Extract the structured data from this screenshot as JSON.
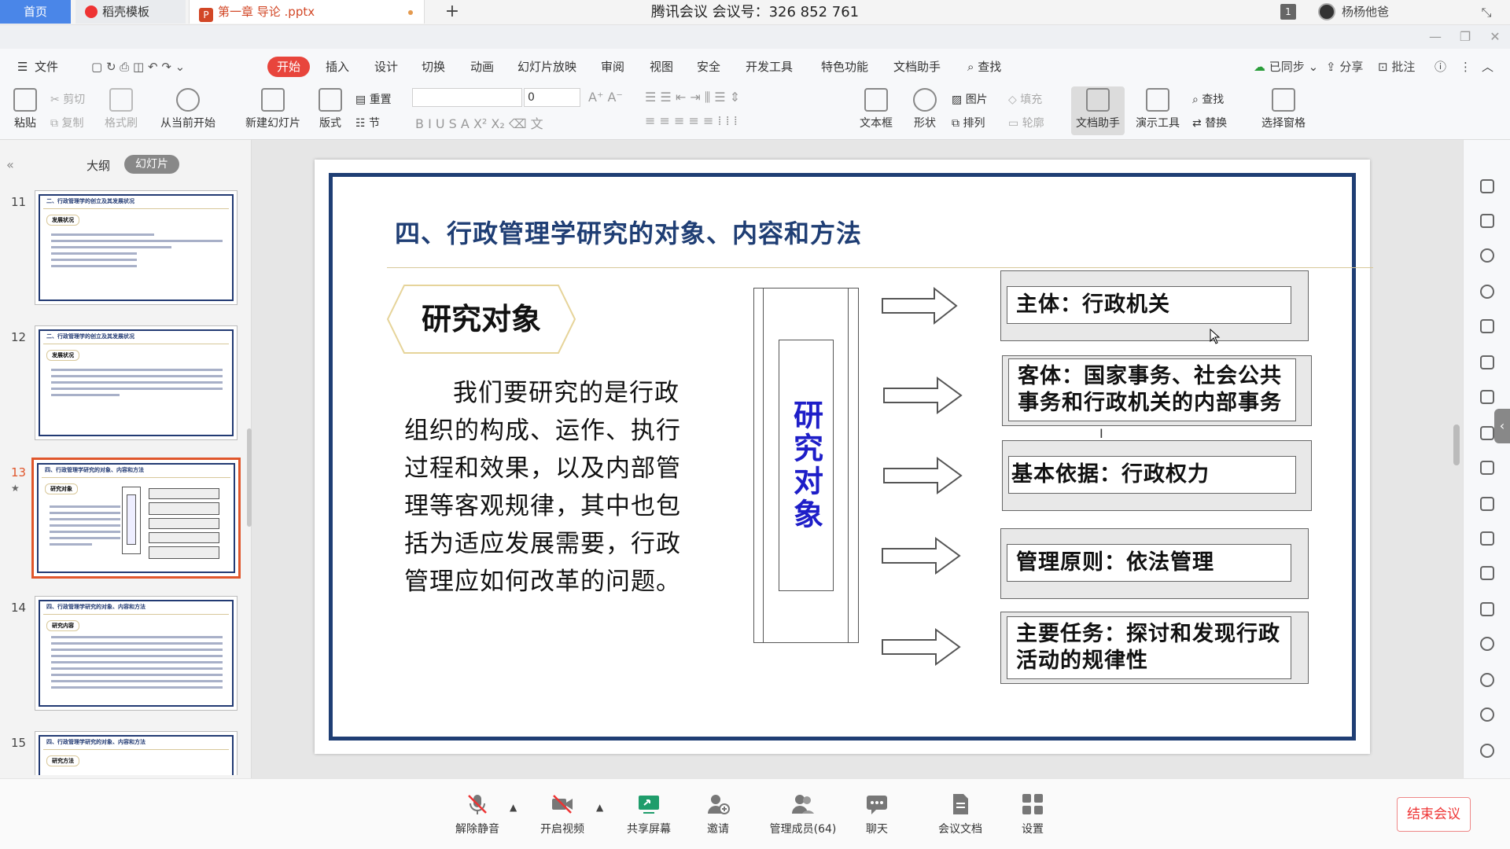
{
  "meeting": {
    "title": "腾讯会议 会议号：326 852 761"
  },
  "tabs": {
    "home": "首页",
    "templates": "稻壳模板",
    "document": "第一章 导论 .pptx",
    "user_name": "杨杨他爸",
    "badge_count": "1"
  },
  "menu": {
    "file": "文件",
    "items": [
      "开始",
      "插入",
      "设计",
      "切换",
      "动画",
      "幻灯片放映",
      "审阅",
      "视图",
      "安全",
      "开发工具",
      "特色功能",
      "文档助手"
    ],
    "search": "查找",
    "sync": "已同步",
    "share": "分享",
    "annotate": "批注"
  },
  "ribbon": {
    "paste": "粘贴",
    "cut": "剪切",
    "copy": "复制",
    "format_painter": "格式刷",
    "from_current": "从当前开始",
    "new_slide": "新建幻灯片",
    "layout": "版式",
    "reset": "重置",
    "section": "节",
    "font_size": "0",
    "textbox": "文本框",
    "shape": "形状",
    "picture": "图片",
    "fill": "填充",
    "arrange": "排列",
    "outline": "轮廓",
    "doc_assistant": "文档助手",
    "present_tools": "演示工具",
    "find": "查找",
    "replace": "替换",
    "select_pane": "选择窗格"
  },
  "left_panel": {
    "outline_tab": "大纲",
    "slides_tab": "幻灯片",
    "thumbnails": [
      {
        "num": "11",
        "title": "二、行政管理学的创立及其发展状况",
        "tag": "发展状况"
      },
      {
        "num": "12",
        "title": "二、行政管理学的创立及其发展状况",
        "tag": "发展状况"
      },
      {
        "num": "13",
        "title": "四、行政管理学研究的对象、内容和方法",
        "tag": "研究对象"
      },
      {
        "num": "14",
        "title": "四、行政管理学研究的对象、内容和方法",
        "tag": "研究内容"
      },
      {
        "num": "15",
        "title": "四、行政管理学研究的对象、内容和方法",
        "tag": "研究方法"
      }
    ]
  },
  "slide": {
    "title": "四、行政管理学研究的对象、内容和方法",
    "heading": "研究对象",
    "body": "我们要研究的是行政组织的构成、运作、执行过程和效果，以及内部管理等客观规律，其中也包括为适应发展需要，行政管理应如何改革的问题。",
    "center_label": "研究对象",
    "boxes": [
      {
        "line1": "主体：行政机关",
        "line2": ""
      },
      {
        "line1": "客体：国家事务、社会公共",
        "line2": "事务和行政机关的内部事务"
      },
      {
        "line1": "基本依据：行政权力",
        "line2": ""
      },
      {
        "line1": "管理原则：依法管理",
        "line2": ""
      },
      {
        "line1": "主要任务：探讨和发现行政",
        "line2": "活动的规律性"
      }
    ]
  },
  "meeting_bar": {
    "unmute": "解除静音",
    "start_video": "开启视频",
    "share_screen": "共享屏幕",
    "invite": "邀请",
    "members": "管理成员(64)",
    "chat": "聊天",
    "docs": "会议文档",
    "settings": "设置",
    "end": "结束会议"
  },
  "colors": {
    "accent_red": "#e8453c",
    "slide_navy": "#1f3e74",
    "center_text_blue": "#1e1ec8",
    "selection_orange": "#e0562b"
  }
}
